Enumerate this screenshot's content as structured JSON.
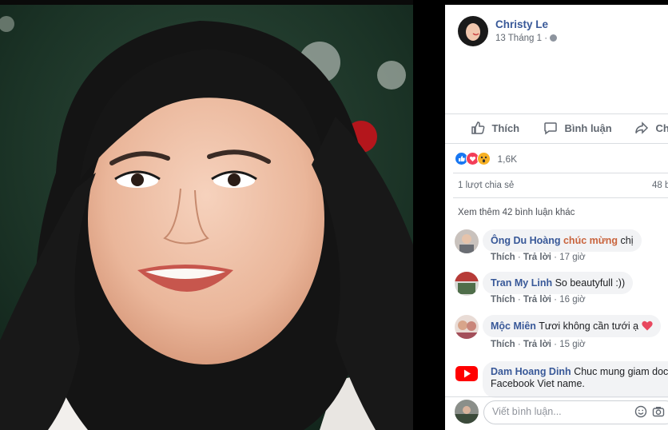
{
  "post": {
    "author": "Christy Le",
    "date": "13 Tháng 1",
    "date_sep": "·",
    "privacy_icon": "globe-icon"
  },
  "actions": {
    "like": "Thích",
    "comment": "Bình luận",
    "share": "Chi"
  },
  "reactions": {
    "count": "1,6K",
    "icons": [
      "like-icon",
      "love-icon",
      "wow-icon"
    ],
    "shares": "1 lượt chia sẻ",
    "comments_count": "48 b"
  },
  "comments": {
    "more": "Xem thêm 42 bình luận khác",
    "items": [
      {
        "name": "Ông Du Hoàng",
        "highlight": "chúc mừng",
        "text": " chị",
        "like": "Thích",
        "reply": "Trả lời",
        "time": "17 giờ"
      },
      {
        "name": "Tran My Linh",
        "text": "So beautyfull :))",
        "like": "Thích",
        "reply": "Trả lời",
        "time": "16 giờ"
      },
      {
        "name": "Mộc Miên",
        "text": "Tươi không cần tưới ạ",
        "like": "Thích",
        "reply": "Trả lời",
        "time": "15 giờ"
      },
      {
        "name": "Dam Hoang Dinh",
        "text": "Chuc mung giam doc",
        "text2": "Facebook Viet name."
      }
    ],
    "dot": "·"
  },
  "composer": {
    "placeholder": "Viết bình luận..."
  },
  "colors": {
    "brand": "#385898",
    "like_blue": "#1877f2",
    "love_red": "#f33e58",
    "wow_yellow": "#f7b125"
  }
}
